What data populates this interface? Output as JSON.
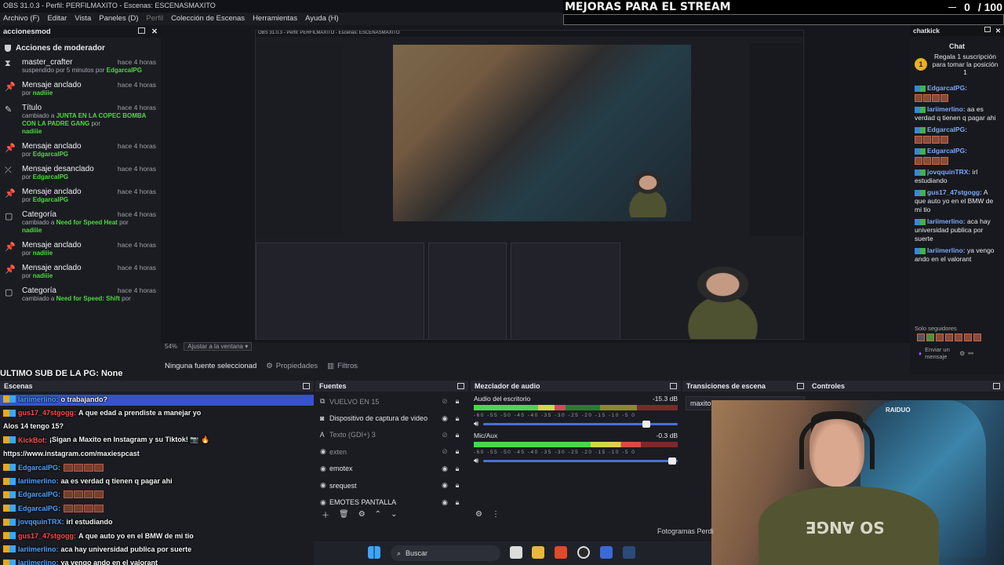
{
  "titlebar": {
    "text": "OBS 31.0.3 - Perfil: PERFILMAXITO - Escenas: ESCENASMAXITO"
  },
  "menu": [
    "Archivo (F)",
    "Editar",
    "Vista",
    "Paneles (D)",
    "Perfil",
    "Colección de Escenas",
    "Herramientas",
    "Ayuda (H)"
  ],
  "overlay": {
    "title": "MEJORAS PARA EL STREAM",
    "count": "0",
    "total": "/ 100",
    "minimize": "—"
  },
  "mod_dock": {
    "tab": "accionesmod",
    "title": "Acciones de moderador",
    "items": [
      {
        "icon": "⧗",
        "name": "master_crafter",
        "time": "hace 4 horas",
        "pre": "suspendido por 5 minutos por",
        "value": "EdgarcalPG"
      },
      {
        "icon": "📌",
        "name": "Mensaje anclado",
        "time": "hace 4 horas",
        "pre": "por",
        "value": "nadiiie"
      },
      {
        "icon": "✎",
        "name": "Título",
        "time": "hace 4 horas",
        "pre": "cambiado a",
        "value": "JUNTA EN LA COPEC BOMBA CON LA PADRE GANG",
        "post": "por",
        "by": "nadiiie"
      },
      {
        "icon": "📌",
        "name": "Mensaje anclado",
        "time": "hace 4 horas",
        "pre": "por",
        "value": "EdgarcalPG"
      },
      {
        "icon": "⤫",
        "name": "Mensaje desanclado",
        "time": "hace 4 horas",
        "pre": "por",
        "value": "EdgarcalPG"
      },
      {
        "icon": "📌",
        "name": "Mensaje anclado",
        "time": "hace 4 horas",
        "pre": "por",
        "value": "EdgarcalPG"
      },
      {
        "icon": "▢",
        "name": "Categoría",
        "time": "hace 4 horas",
        "pre": "cambiado a",
        "value": "Need for Speed Heat",
        "post": "por",
        "by": "nadiiie"
      },
      {
        "icon": "📌",
        "name": "Mensaje anclado",
        "time": "hace 4 horas",
        "pre": "por",
        "value": "nadiiie"
      },
      {
        "icon": "📌",
        "name": "Mensaje anclado",
        "time": "hace 4 horas",
        "pre": "por",
        "value": "nadiiie"
      },
      {
        "icon": "▢",
        "name": "Categoría",
        "time": "hace 4 horas",
        "pre": "cambiado a",
        "value": "Need for Speed: Shift",
        "post": "por",
        "by": ""
      }
    ]
  },
  "ultimo": "ULTIMO SUB DE LA PG: None",
  "preview": {
    "zoom": "54%",
    "fit": "Ajustar a la ventana"
  },
  "source_toolbar": {
    "no_source": "Ninguna fuente seleccionad",
    "properties": "Propiedades",
    "filters": "Filtros"
  },
  "chat": {
    "tab": "chatkick",
    "title": "Chat",
    "pinned": "Regala 1 suscripción para tomar la posición 1",
    "lines": [
      {
        "user": "EdgarcalPG:",
        "text": "",
        "emotes": 4
      },
      {
        "user": "lariimerlino:",
        "text": "aa es verdad q tienen q pagar ahi"
      },
      {
        "user": "EdgarcalPG:",
        "text": "",
        "emotes": 4
      },
      {
        "user": "EdgarcalPG:",
        "text": "",
        "emotes": 4
      },
      {
        "user": "jovqquinTRX:",
        "text": "irl estudiando"
      },
      {
        "user": "gus17_47stgogg:",
        "text": "A que auto yo en el BMW de mi tio"
      },
      {
        "user": "lariimerlino:",
        "text": "aca hay universidad publica por suerte"
      },
      {
        "user": "lariimerlino:",
        "text": "ya vengo ando en el valorant"
      }
    ],
    "followers": "Solo seguidores",
    "send": "Enviar",
    "send_placeholder": "Enviar un mensaje"
  },
  "docks": {
    "escenas": "Escenas",
    "fuentes": "Fuentes",
    "mixer": "Mezclador de audio",
    "transiciones": "Transiciones de escena",
    "controles": "Controles"
  },
  "chat_overlay": [
    {
      "user": "lariimerlino:",
      "text": "o trabajando?",
      "red": false
    },
    {
      "user": "gus17_47stgogg:",
      "text": "A que edad a prendiste a manejar yo",
      "red": true
    },
    {
      "user": "",
      "text": "Alos 14 tengo 15?",
      "red": false
    },
    {
      "user": "KickBot:",
      "text": "¡Sigan a Maxito en Instagram y su Tiktok! 📷 🔥",
      "red": true
    },
    {
      "user": "",
      "text": "https://www.instagram.com/maxiespcast",
      "red": false
    },
    {
      "user": "EdgarcalPG:",
      "text": "",
      "red": false,
      "emotes": 4
    },
    {
      "user": "lariimerlino:",
      "text": "aa es verdad q tienen q pagar ahi",
      "red": false
    },
    {
      "user": "EdgarcalPG:",
      "text": "",
      "red": false,
      "emotes": 4
    },
    {
      "user": "EdgarcalPG:",
      "text": "",
      "red": false,
      "emotes": 4
    },
    {
      "user": "jovqquinTRX:",
      "text": "irl estudiando",
      "red": false
    },
    {
      "user": "gus17_47stgogg:",
      "text": "A que auto yo en el BMW de mi tio",
      "red": true
    },
    {
      "user": "lariimerlino:",
      "text": "aca hay universidad publica por suerte",
      "red": false
    },
    {
      "user": "lariimerlino:",
      "text": "ya vengo ando en el valorant",
      "red": false
    }
  ],
  "sources": [
    {
      "icon": "⧉",
      "name": "VUELVO EN 15",
      "dim": true,
      "visible": false
    },
    {
      "icon": "◙",
      "name": "Dispositivo de captura de video",
      "dim": false,
      "visible": true
    },
    {
      "icon": "Ꭺ",
      "name": "Texto (GDI+) 3",
      "dim": true,
      "visible": false
    },
    {
      "icon": "◉",
      "name": "exten",
      "dim": true,
      "visible": false
    },
    {
      "icon": "◉",
      "name": "emotex",
      "dim": false,
      "visible": true
    },
    {
      "icon": "◉",
      "name": "srequest",
      "dim": false,
      "visible": true
    },
    {
      "icon": "◉",
      "name": "EMOTES PANTALLA",
      "dim": false,
      "visible": true
    }
  ],
  "mixer": {
    "channels": [
      {
        "name": "Audio del escritorio",
        "db": "-15.3 dB",
        "level": 0.45,
        "volume": 0.86
      },
      {
        "name": "Mic/Aux",
        "db": "-0.3 dB",
        "level": 0.82,
        "volume": 0.99
      }
    ],
    "scale": "-60 -55 -50 -45 -40 -35 -30 -25 -20 -15 -10 -5 0"
  },
  "transition": {
    "value": "maxito"
  },
  "webcam": {
    "shirt": "SO ANGE",
    "chair_logo": "RAIDUO"
  },
  "fotogramas": "Fotogramas Perdi",
  "taskbar": {
    "search": "Buscar"
  }
}
